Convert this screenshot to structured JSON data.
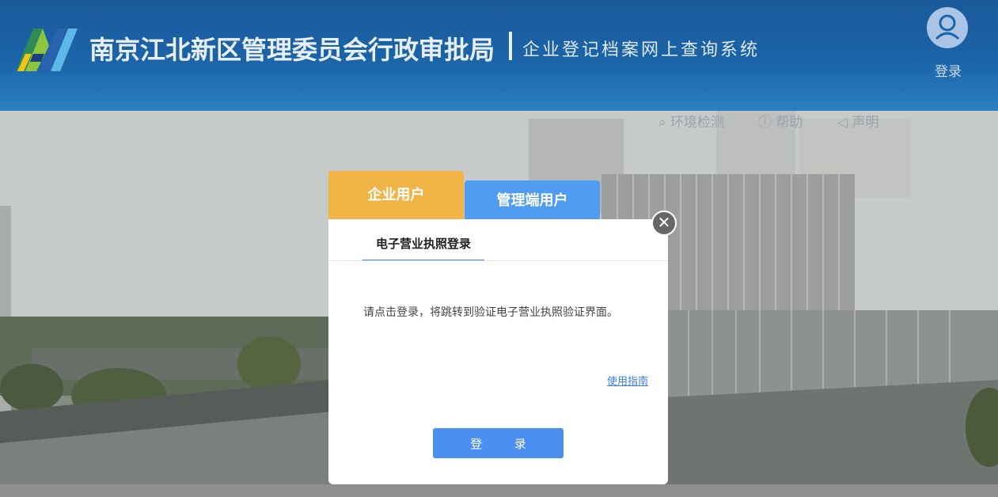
{
  "header": {
    "title": "南京江北新区管理委员会行政审批局",
    "subtitle": "企业登记档案网上查询系统",
    "user_label": "登录"
  },
  "topnav": {
    "items": [
      {
        "label": "环境检测",
        "icon": "search-icon"
      },
      {
        "label": "帮助",
        "icon": "question-icon"
      },
      {
        "label": "声明",
        "icon": "speaker-icon"
      }
    ]
  },
  "modal": {
    "tabs": [
      {
        "label": "企业用户",
        "active": true
      },
      {
        "label": "管理端用户",
        "active": false
      }
    ],
    "subtab": "电子营业执照登录",
    "message": "请点击登录，将跳转到验证电子营业执照验证界面。",
    "guide_link": "使用指南",
    "login_button": "登 录",
    "close_icon": "close-icon"
  },
  "colors": {
    "header_blue": "#1b64a8",
    "tab_active": "#f2b347",
    "tab_inactive": "#4f9cf0",
    "button": "#4c8ff2"
  }
}
